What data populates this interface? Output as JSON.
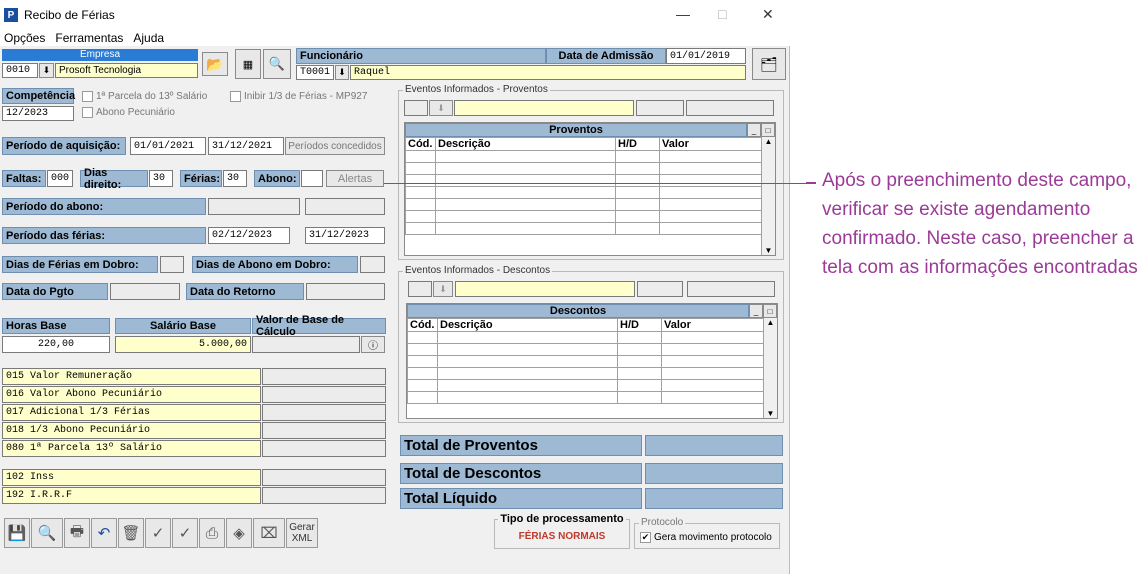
{
  "window": {
    "title": "Recibo de Férias",
    "minimize": "—",
    "maximize": "□",
    "close": "✕"
  },
  "menu": [
    "Opções",
    "Ferramentas",
    "Ajuda"
  ],
  "empresa": {
    "label": "Empresa",
    "code": "0010",
    "name": "Prosoft Tecnologia"
  },
  "funcionario": {
    "label": "Funcionário",
    "code": "T0001",
    "name": "Raquel",
    "admissao_label": "Data de Admissão",
    "admissao": "01/01/2019"
  },
  "competencia": {
    "label": "Competência",
    "value": "12/2023",
    "parcela13": "1ª Parcela do 13º Salário",
    "inibir": "Inibir 1/3 de Férias - MP927",
    "abono": "Abono Pecuniário"
  },
  "aquisicao": {
    "label": "Período de aquisição:",
    "inicio": "01/01/2021",
    "fim": "31/12/2021",
    "btn": "Períodos concedidos"
  },
  "faltas": {
    "label": "Faltas:",
    "value": "000",
    "direito_label": "Dias direito:",
    "direito": "30",
    "ferias_label": "Férias:",
    "ferias": "30",
    "abono_label": "Abono:",
    "abono": "",
    "alertas": "Alertas"
  },
  "periodo_abono": {
    "label": "Período do abono:"
  },
  "periodo_ferias": {
    "label": "Período das férias:",
    "inicio": "02/12/2023",
    "fim": "31/12/2023"
  },
  "dobro": {
    "ferias_label": "Dias de Férias em Dobro:",
    "abono_label": "Dias de Abono em Dobro:"
  },
  "datas": {
    "pgto_label": "Data do Pgto",
    "retorno_label": "Data do Retorno"
  },
  "base": {
    "horas_label": "Horas Base",
    "horas": "220,00",
    "salario_label": "Salário Base",
    "salario": "5.000,00",
    "calculo_label": "Valor de Base de Cálculo"
  },
  "eventos_proventos": [
    {
      "code": "015",
      "desc": "Valor Remuneração"
    },
    {
      "code": "016",
      "desc": "Valor Abono Pecuniário"
    },
    {
      "code": "017",
      "desc": "Adicional 1/3 Férias"
    },
    {
      "code": "018",
      "desc": "1/3 Abono Pecuniário"
    },
    {
      "code": "080",
      "desc": "1ª Parcela 13º Salário"
    }
  ],
  "eventos_descontos": [
    {
      "code": "102",
      "desc": "Inss"
    },
    {
      "code": "192",
      "desc": "I.R.R.F"
    }
  ],
  "proventos_group": {
    "title": "Eventos Informados - Proventos",
    "grid_title": "Proventos",
    "cols": [
      "Cód.",
      "Descrição",
      "H/D",
      "Valor"
    ]
  },
  "descontos_group": {
    "title": "Eventos Informados - Descontos",
    "grid_title": "Descontos",
    "cols": [
      "Cód.",
      "Descrição",
      "H/D",
      "Valor"
    ]
  },
  "totais": {
    "proventos": "Total de Proventos",
    "descontos": "Total de Descontos",
    "liquido": "Total Líquido"
  },
  "processamento": {
    "label": "Tipo de processamento",
    "value": "FÉRIAS NORMAIS"
  },
  "protocolo": {
    "label": "Protocolo",
    "check": "Gera movimento protocolo"
  },
  "toolbar": {
    "gerar": "Gerar",
    "xml": "XML"
  },
  "annotation": "Após o preenchimento deste campo, verificar se existe agendamento confirmado. Neste caso, preencher a tela com as informações encontradas",
  "colors": {
    "label_blue": "#9db9d4",
    "field_yellow": "#ffffcc",
    "annotation": "#9b3b97",
    "process_red": "#c0392b"
  }
}
